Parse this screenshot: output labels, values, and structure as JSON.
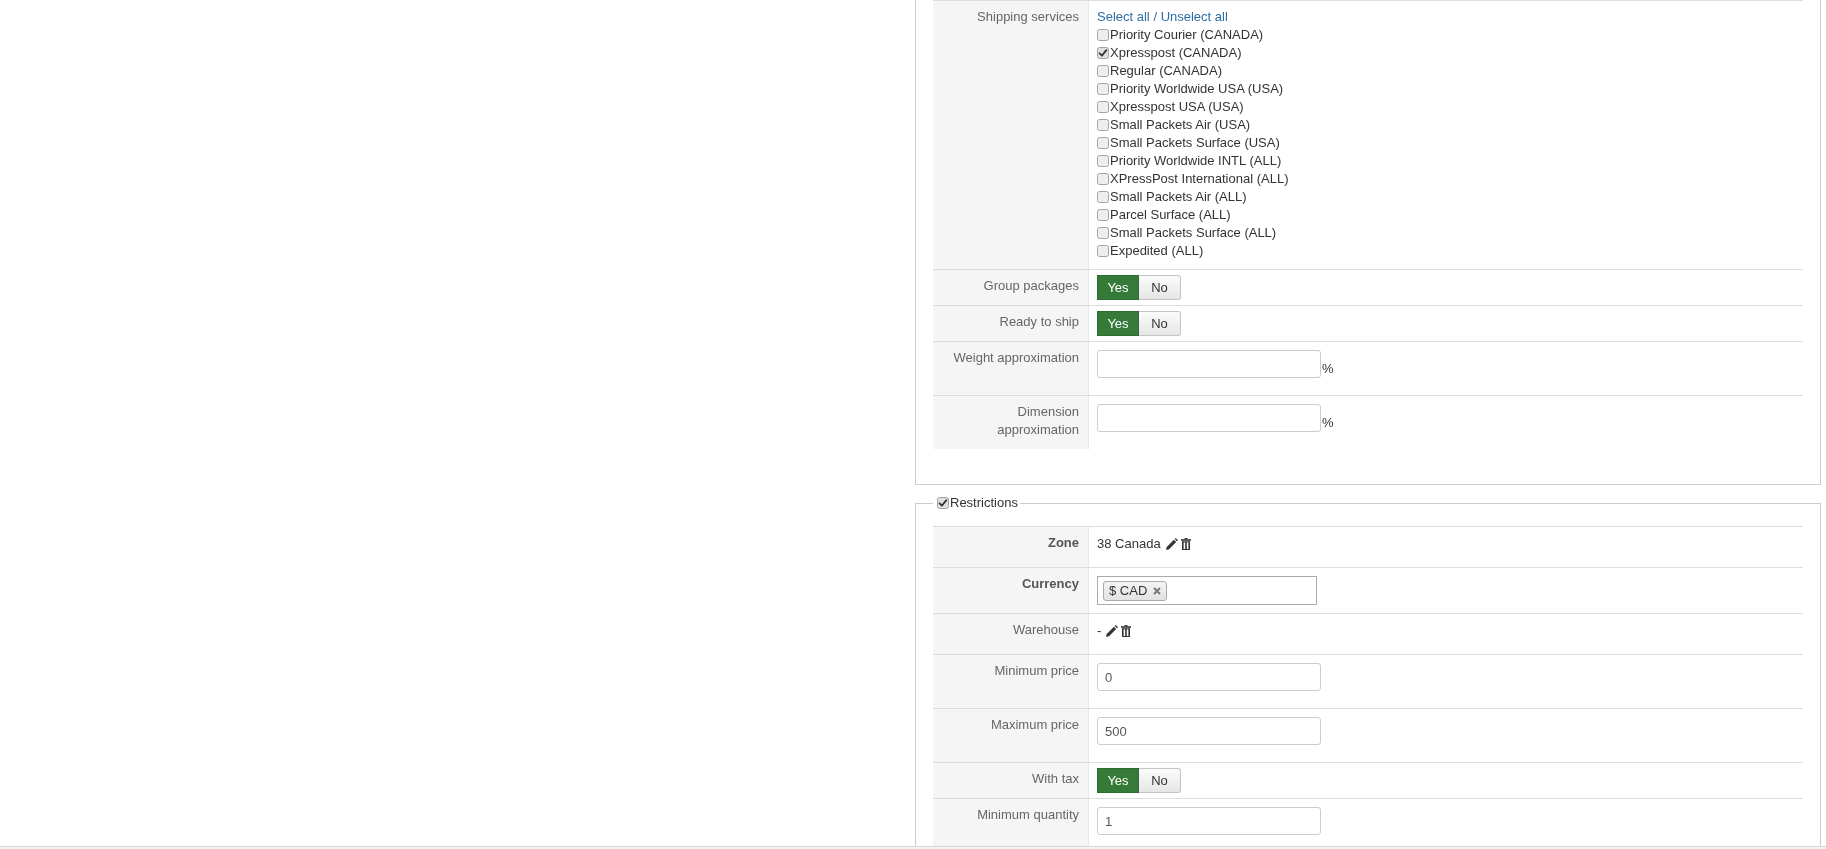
{
  "shipping": {
    "rows": [
      {
        "kind": "checkbox_list",
        "label": "Shipping services",
        "select_all": "Select all",
        "separator": "/",
        "unselect_all": "Unselect all",
        "items": [
          {
            "label": "Priority Courier (CANADA)",
            "checked": false
          },
          {
            "label": "Xpresspost (CANADA)",
            "checked": true
          },
          {
            "label": "Regular (CANADA)",
            "checked": false
          },
          {
            "label": "Priority Worldwide USA (USA)",
            "checked": false
          },
          {
            "label": "Xpresspost USA (USA)",
            "checked": false
          },
          {
            "label": "Small Packets Air (USA)",
            "checked": false
          },
          {
            "label": "Small Packets Surface (USA)",
            "checked": false
          },
          {
            "label": "Priority Worldwide INTL (ALL)",
            "checked": false
          },
          {
            "label": "XPressPost International (ALL)",
            "checked": false
          },
          {
            "label": "Small Packets Air (ALL)",
            "checked": false
          },
          {
            "label": "Parcel Surface (ALL)",
            "checked": false
          },
          {
            "label": "Small Packets Surface (ALL)",
            "checked": false
          },
          {
            "label": "Expedited (ALL)",
            "checked": false
          }
        ]
      },
      {
        "kind": "toggle",
        "label": "Group packages",
        "options": [
          {
            "label": "Yes",
            "selected": true
          },
          {
            "label": "No",
            "selected": false
          }
        ]
      },
      {
        "kind": "toggle",
        "label": "Ready to ship",
        "options": [
          {
            "label": "Yes",
            "selected": true
          },
          {
            "label": "No",
            "selected": false
          }
        ]
      },
      {
        "kind": "input",
        "label": "Weight approximation",
        "suffix": "%"
      },
      {
        "kind": "input",
        "label": "Dimension approximation",
        "suffix": "%"
      }
    ]
  },
  "restrictions": {
    "title": "Restrictions",
    "enabled": true,
    "rows": [
      {
        "kind": "value_actions",
        "label": "Zone",
        "emphasized": true,
        "value": "38 Canada"
      },
      {
        "kind": "tag_select",
        "label": "Currency",
        "emphasized": true,
        "tags": [
          "$ CAD"
        ]
      },
      {
        "kind": "value_actions",
        "label": "Warehouse",
        "emphasized": false,
        "value": "-"
      },
      {
        "kind": "input",
        "label": "Minimum price",
        "emphasized": false,
        "value": "0"
      },
      {
        "kind": "input",
        "label": "Maximum price",
        "emphasized": false,
        "value": "500"
      },
      {
        "kind": "toggle",
        "label": "With tax",
        "emphasized": false,
        "options": [
          {
            "label": "Yes",
            "selected": true
          },
          {
            "label": "No",
            "selected": false
          }
        ]
      },
      {
        "kind": "input",
        "label": "Minimum quantity",
        "emphasized": false,
        "value": "1"
      }
    ]
  }
}
